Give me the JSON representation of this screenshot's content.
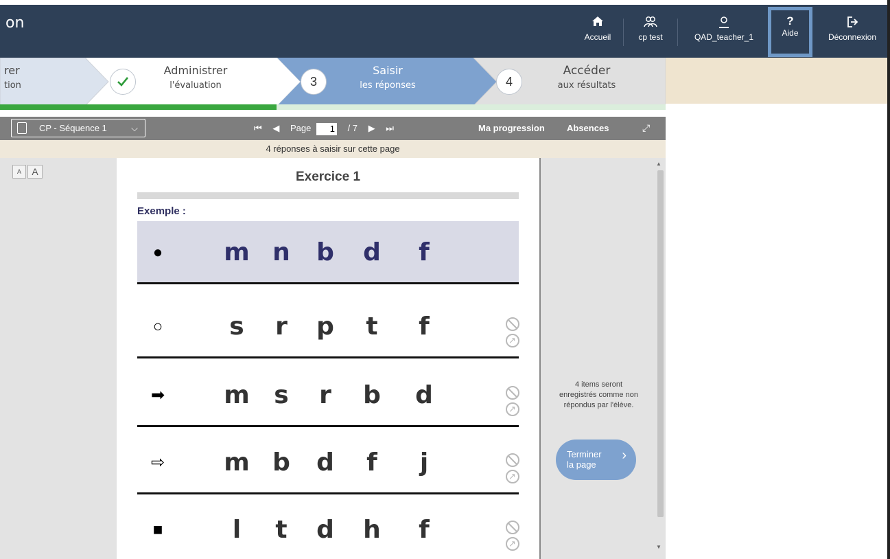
{
  "header": {
    "app_title_fragment": "on",
    "nav": [
      {
        "label": "Accueil",
        "icon": "home-icon"
      },
      {
        "label": "cp test",
        "icon": "group-icon"
      },
      {
        "label": "QAD_teacher_1",
        "icon": "user-icon"
      },
      {
        "label": "Aide",
        "icon": "question-icon"
      },
      {
        "label": "Déconnexion",
        "icon": "logout-icon"
      }
    ]
  },
  "stepper": {
    "steps": [
      {
        "title": "rer",
        "subtitle": "tion"
      },
      {
        "title": "Administrer",
        "subtitle": "l'évaluation",
        "status": "done"
      },
      {
        "number": "3",
        "title": "Saisir",
        "subtitle": "les réponses",
        "status": "active"
      },
      {
        "number": "4",
        "title": "Accéder",
        "subtitle": "aux résultats"
      }
    ],
    "progress_fraction": 0.415
  },
  "toolbar": {
    "sequence": "CP - Séquence 1",
    "page_label": "Page",
    "page_current": "1",
    "page_total": "/ 7",
    "ma_progression": "Ma progression",
    "absences": "Absences"
  },
  "info_bar": "4 réponses à saisir sur cette page",
  "font_buttons": {
    "small": "A",
    "large": "A"
  },
  "exercise": {
    "title": "Exercice 1",
    "example_label": "Exemple :",
    "rows": [
      {
        "symbol": "●",
        "letters": [
          "m",
          "n",
          "b",
          "d",
          "f"
        ]
      },
      {
        "symbol": "○",
        "letters": [
          "s",
          "r",
          "p",
          "t",
          "f"
        ]
      },
      {
        "symbol": "➡",
        "letters": [
          "m",
          "s",
          "r",
          "b",
          "d"
        ]
      },
      {
        "symbol": "⇨",
        "letters": [
          "m",
          "b",
          "d",
          "f",
          "j"
        ]
      },
      {
        "symbol": "■",
        "letters": [
          "l",
          "t",
          "d",
          "h",
          "f"
        ]
      }
    ]
  },
  "side_panel": {
    "message": "4 items seront enregistrés comme non répondus par l'élève.",
    "finish_line1": "Terminer",
    "finish_line2": "la page"
  },
  "colors": {
    "header_bg": "#2e4057",
    "active_step": "#7ea2cf",
    "progress": "#3aa73f",
    "toolbar": "#7e7e7e"
  }
}
